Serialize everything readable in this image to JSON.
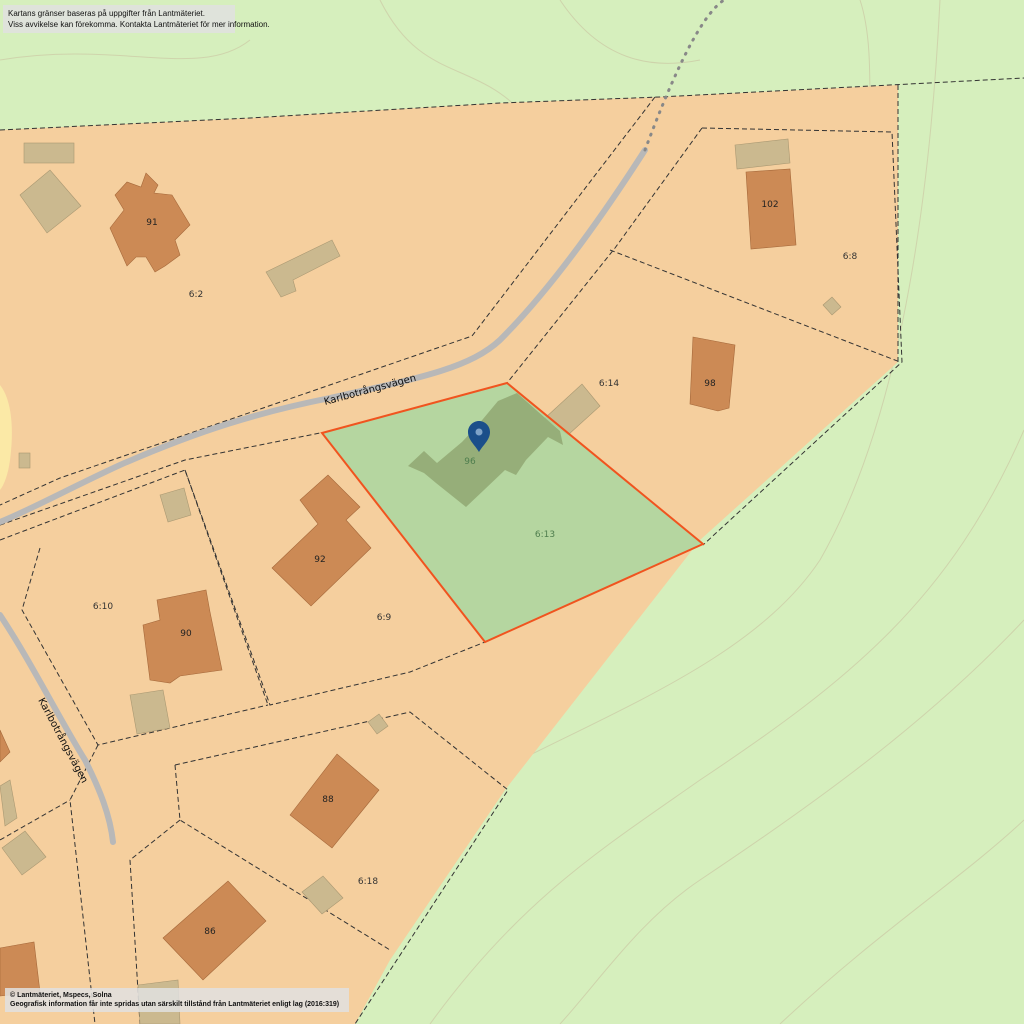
{
  "map": {
    "colors": {
      "background": "#d6efbd",
      "residential": "#f5cf9e",
      "building": "#cc8a55",
      "outbuilding": "#cbb98f",
      "road": "#b8b8b8",
      "selected_fill": "#a9d7a0",
      "selected_border": "#f0541f",
      "marker": "#1b4f8a"
    },
    "marker_icon": "map-pin-icon",
    "roads": [
      {
        "name": "Karlbotrångsvägen"
      },
      {
        "name": "Karlbotrångsvägen"
      }
    ],
    "buildings": [
      {
        "number": "91"
      },
      {
        "number": "102"
      },
      {
        "number": "98"
      },
      {
        "number": "92"
      },
      {
        "number": "90"
      },
      {
        "number": "88"
      },
      {
        "number": "86"
      }
    ],
    "selected_building_number": "96",
    "plots": [
      {
        "id": "6:2"
      },
      {
        "id": "6:8"
      },
      {
        "id": "6:14"
      },
      {
        "id": "6:13"
      },
      {
        "id": "6:9"
      },
      {
        "id": "6:10"
      },
      {
        "id": "6:18"
      }
    ]
  },
  "notices": {
    "top_line1": "Kartans gränser baseras på uppgifter från Lantmäteriet.",
    "top_line2": "Viss avvikelse kan förekomma. Kontakta Lantmäteriet för mer information.",
    "bottom_line1": "© Lantmäteriet, Mspecs, Solna",
    "bottom_line2": "Geografisk information får inte spridas utan särskilt tillstånd från Lantmäteriet enligt lag (2016:319)"
  }
}
